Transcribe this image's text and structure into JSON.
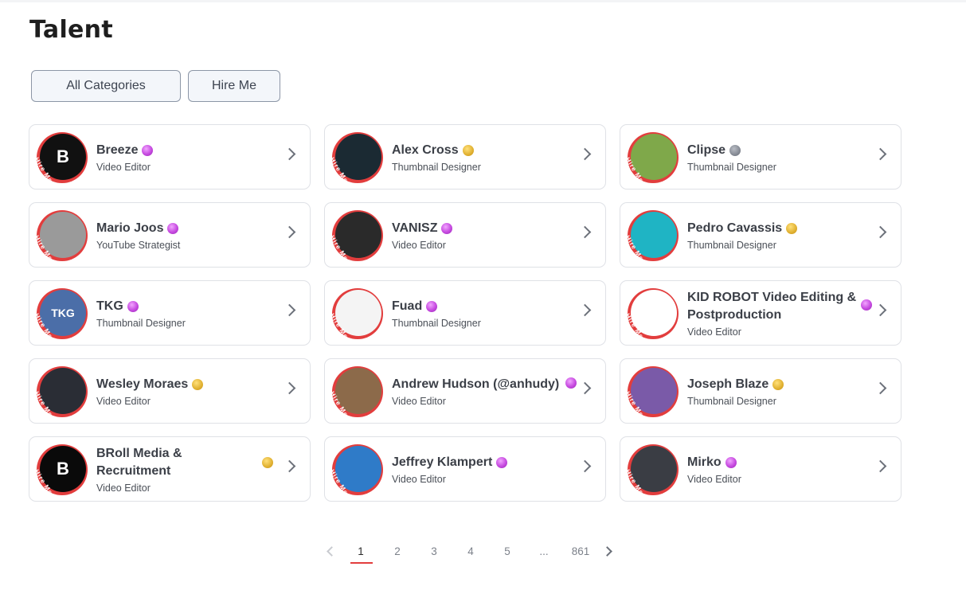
{
  "page": {
    "title": "Talent"
  },
  "filters": [
    {
      "label": "All Categories",
      "key": "all"
    },
    {
      "label": "Hire Me",
      "key": "hire"
    }
  ],
  "hire_tag": "Hire Me",
  "talents": [
    {
      "name": "Breeze",
      "role": "Video Editor",
      "badge": "purple",
      "avatar_color": "#111111",
      "avatar_text": "B"
    },
    {
      "name": "Alex Cross",
      "role": "Thumbnail Designer",
      "badge": "gold",
      "avatar_color": "#1b2a33",
      "avatar_text": ""
    },
    {
      "name": "Clipse",
      "role": "Thumbnail Designer",
      "badge": "gray",
      "avatar_color": "#7fa84a",
      "avatar_text": ""
    },
    {
      "name": "Mario Joos",
      "role": "YouTube Strategist",
      "badge": "purple",
      "avatar_color": "#9a9a9a",
      "avatar_text": ""
    },
    {
      "name": "VANISZ",
      "role": "Video Editor",
      "badge": "purple",
      "avatar_color": "#2a2a2a",
      "avatar_text": ""
    },
    {
      "name": "Pedro Cavassis",
      "role": "Thumbnail Designer",
      "badge": "gold",
      "avatar_color": "#1fb4c4",
      "avatar_text": ""
    },
    {
      "name": "TKG",
      "role": "Thumbnail Designer",
      "badge": "purple",
      "avatar_color": "#4b6ea8",
      "avatar_text": "TKG"
    },
    {
      "name": "Fuad",
      "role": "Thumbnail Designer",
      "badge": "purple",
      "avatar_color": "#f4f4f4",
      "avatar_text": ""
    },
    {
      "name": "KID ROBOT Video Editing & Postproduction",
      "role": "Video Editor",
      "badge": "purple",
      "avatar_color": "#ffffff",
      "avatar_text": "",
      "side_badge": true
    },
    {
      "name": "Wesley Moraes",
      "role": "Video Editor",
      "badge": "gold",
      "avatar_color": "#2a2d35",
      "avatar_text": ""
    },
    {
      "name": "Andrew Hudson (@anhudy)",
      "role": "Video Editor",
      "badge": "purple",
      "avatar_color": "#8c6a4a",
      "avatar_text": "",
      "side_badge": true
    },
    {
      "name": "Joseph Blaze",
      "role": "Thumbnail Designer",
      "badge": "gold",
      "avatar_color": "#7a5aa8",
      "avatar_text": ""
    },
    {
      "name": "BRoll Media & Recruitment",
      "role": "Video Editor",
      "badge": "gold",
      "avatar_color": "#0a0a0a",
      "avatar_text": "B"
    },
    {
      "name": "Jeffrey Klampert",
      "role": "Video Editor",
      "badge": "purple",
      "avatar_color": "#2f7bc8",
      "avatar_text": ""
    },
    {
      "name": "Mirko",
      "role": "Video Editor",
      "badge": "purple",
      "avatar_color": "#3a3d44",
      "avatar_text": ""
    }
  ],
  "pagination": {
    "pages": [
      "1",
      "2",
      "3",
      "4",
      "5",
      "...",
      "861"
    ],
    "current": "1"
  }
}
